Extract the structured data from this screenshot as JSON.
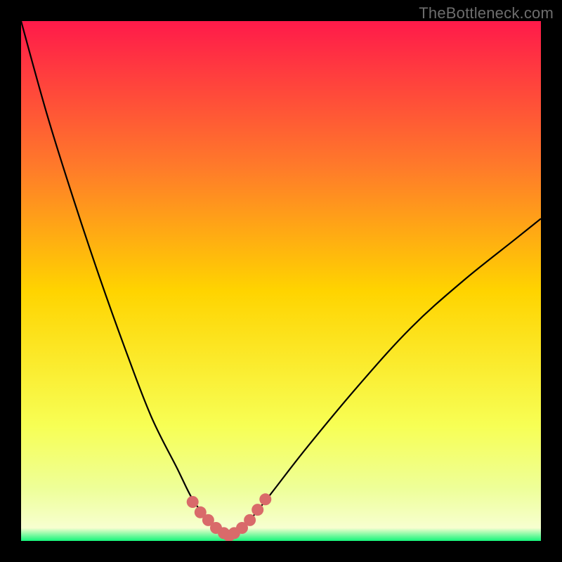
{
  "attribution": "TheBottleneck.com",
  "colors": {
    "bg": "#000000",
    "gradient_top": "#ff1a4a",
    "gradient_upper_mid": "#ff7a2a",
    "gradient_mid": "#ffd400",
    "gradient_lower_mid": "#f7ff55",
    "gradient_low_band": "#eeff99",
    "gradient_bottom": "#15f57a",
    "curve": "#000000",
    "marker": "#d96a6a"
  },
  "chart_data": {
    "type": "line",
    "title": "",
    "xlabel": "",
    "ylabel": "",
    "xlim": [
      0,
      100
    ],
    "ylim": [
      0,
      100
    ],
    "series": [
      {
        "name": "bottleneck-curve",
        "x": [
          0,
          5,
          10,
          15,
          20,
          25,
          30,
          33,
          36,
          38,
          40,
          42,
          44,
          48,
          55,
          65,
          75,
          85,
          95,
          100
        ],
        "y": [
          100,
          82,
          66,
          51,
          37,
          24,
          14,
          8,
          4,
          2,
          1,
          2,
          4,
          9,
          18,
          30,
          41,
          50,
          58,
          62
        ]
      }
    ],
    "markers": {
      "name": "highlight-segment",
      "x": [
        33,
        34.5,
        36,
        37.5,
        39,
        40,
        41,
        42.5,
        44,
        45.5,
        47
      ],
      "y": [
        7.5,
        5.5,
        4,
        2.5,
        1.5,
        1,
        1.5,
        2.5,
        4,
        6,
        8
      ]
    }
  }
}
